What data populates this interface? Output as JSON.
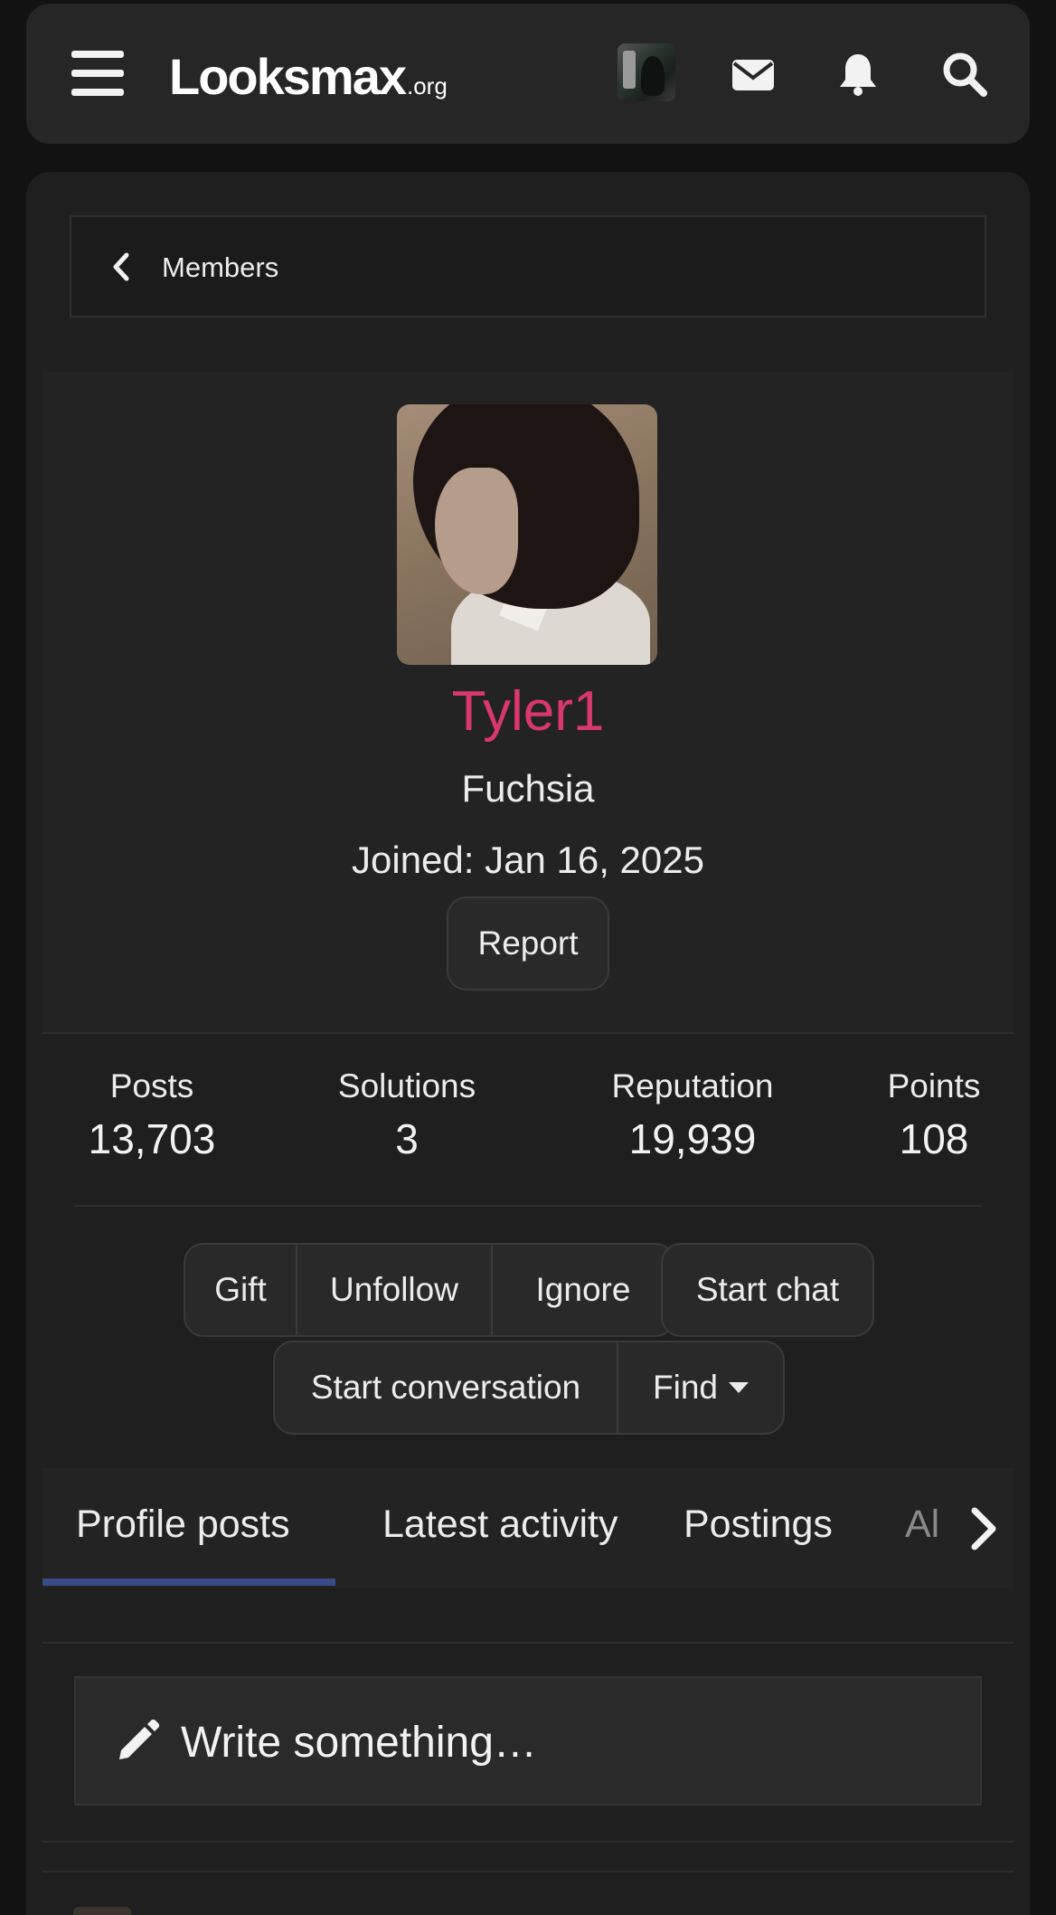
{
  "header": {
    "menu_icon": "hamburger-icon",
    "logo_main": "Looksmax",
    "logo_tld": ".org",
    "icons": [
      "account-avatar",
      "envelope-icon",
      "bell-icon",
      "search-icon"
    ]
  },
  "breadcrumb": {
    "icon": "chevron-left-icon",
    "label": "Members"
  },
  "profile": {
    "username": "Tyler1",
    "user_title": "Fuchsia",
    "joined": "Joined: Jan 16, 2025",
    "report_label": "Report",
    "username_color": "#d9386e"
  },
  "stats": [
    {
      "label": "Posts",
      "value": "13,703"
    },
    {
      "label": "Solutions",
      "value": "3"
    },
    {
      "label": "Reputation",
      "value": "19,939"
    },
    {
      "label": "Points",
      "value": "108"
    }
  ],
  "actions": {
    "gift": "Gift",
    "unfollow": "Unfollow",
    "ignore": "Ignore",
    "start_chat": "Start chat",
    "start_conversation": "Start conversation",
    "find": "Find"
  },
  "tabs": [
    {
      "label": "Profile posts",
      "active": true
    },
    {
      "label": "Latest activity",
      "active": false
    },
    {
      "label": "Postings",
      "active": false
    },
    {
      "label": "Al",
      "active": false
    }
  ],
  "composer": {
    "icon": "pencil-icon",
    "placeholder": "Write something…"
  },
  "colors": {
    "accent": "#3a4a86",
    "background": "#121212",
    "panel": "#232323"
  }
}
